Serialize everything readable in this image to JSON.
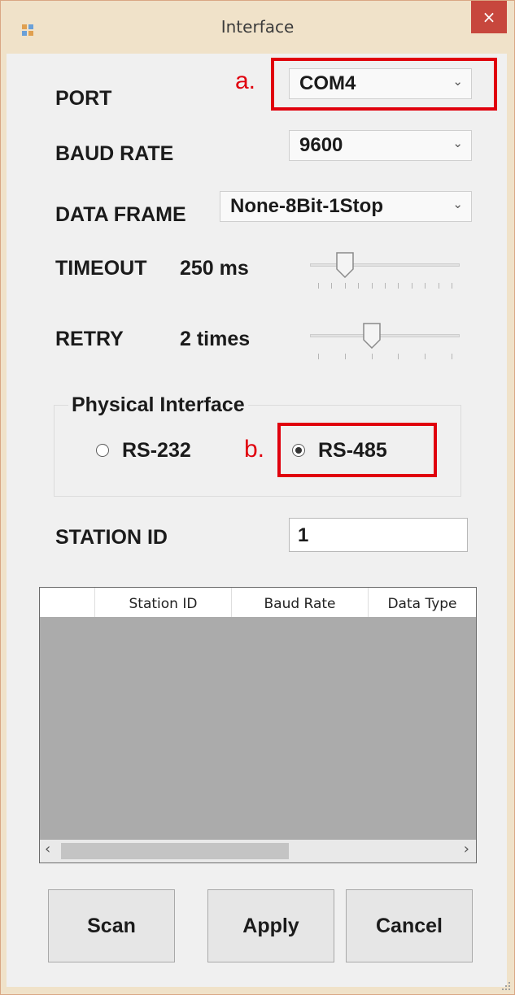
{
  "window": {
    "title": "Interface",
    "close_glyph": "×",
    "app_icon": "app-window-icon"
  },
  "port": {
    "label": "PORT",
    "value": "COM4"
  },
  "baud": {
    "label": "BAUD RATE",
    "value": "9600"
  },
  "frame": {
    "label": "DATA FRAME",
    "value": "None-8Bit-1Stop"
  },
  "timeout": {
    "label": "TIMEOUT",
    "value": "250 ms",
    "slider_level": 0.2
  },
  "retry": {
    "label": "RETRY",
    "value": "2 times",
    "slider_level": 0.4
  },
  "physical": {
    "title": "Physical Interface",
    "options": [
      {
        "label": "RS-232",
        "selected": false
      },
      {
        "label": "RS-485",
        "selected": true
      }
    ]
  },
  "station": {
    "label": "STATION ID",
    "value": "1"
  },
  "grid": {
    "columns": [
      "",
      "Station ID",
      "Baud Rate",
      "Data Type"
    ]
  },
  "annotations": {
    "a": "a.",
    "b": "b.",
    "color": "#e0000d"
  },
  "buttons": {
    "scan": "Scan",
    "apply": "Apply",
    "cancel": "Cancel"
  },
  "colors": {
    "highlight": "#e0000d",
    "grid_background": "#ababab",
    "close_button": "#c7473d"
  }
}
